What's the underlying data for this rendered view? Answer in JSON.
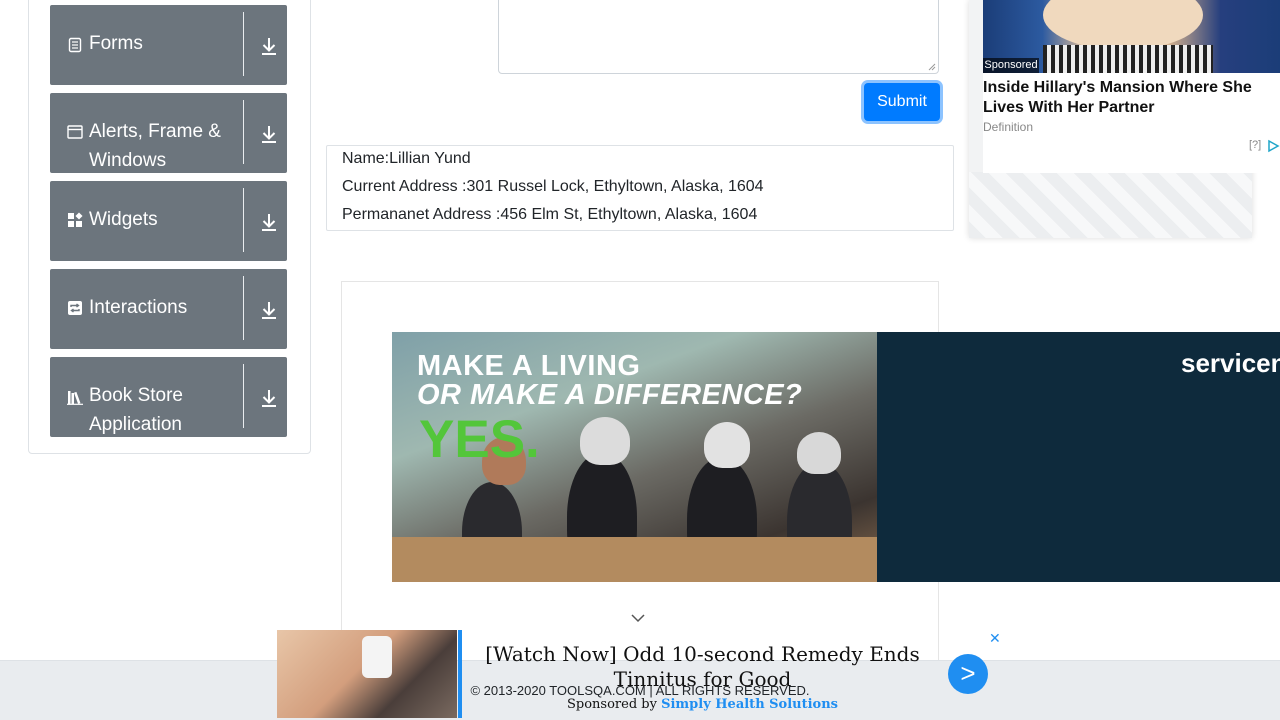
{
  "sidebar": {
    "groups": [
      {
        "label": "Forms",
        "icon": "document-icon"
      },
      {
        "label": "Alerts, Frame & Windows",
        "icon": "window-icon"
      },
      {
        "label": "Widgets",
        "icon": "widgets-icon"
      },
      {
        "label": "Interactions",
        "icon": "interactions-icon"
      },
      {
        "label": "Book Store Application",
        "icon": "books-icon"
      }
    ]
  },
  "form": {
    "submit_label": "Submit"
  },
  "output": {
    "name": "Name:Lillian Yund",
    "current_address": "Current Address :301 Russel Lock, Ethyltown, Alaska, 1604",
    "permanent_address": "Permananet Address :456 Elm St, Ethyltown, Alaska, 1604"
  },
  "banner_ad": {
    "line1": "MAKE A LIVING",
    "line2": "OR MAKE A DIFFERENCE?",
    "line3": "YES.",
    "brand": "servicen"
  },
  "side_ad": {
    "badge": "Sponsored",
    "title": "Inside Hillary's Mansion Where She Lives With Her Partner",
    "source": "Definition",
    "info": "[?]"
  },
  "bottom_ad": {
    "title": "[Watch Now] Odd 10-second Remedy Ends Tinnitus for Good",
    "sponsored_prefix": "Sponsored by ",
    "sponsor": "Simply Health Solutions",
    "arrow": ">",
    "close": "✕"
  },
  "footer": {
    "text": "© 2013-2020 TOOLSQA.COM | ALL RIGHTS RESERVED."
  },
  "colors": {
    "primary": "#007bff",
    "group_bg": "#6c757d",
    "ad_blue": "#1f8ef1",
    "banner_green": "#53c63a"
  }
}
